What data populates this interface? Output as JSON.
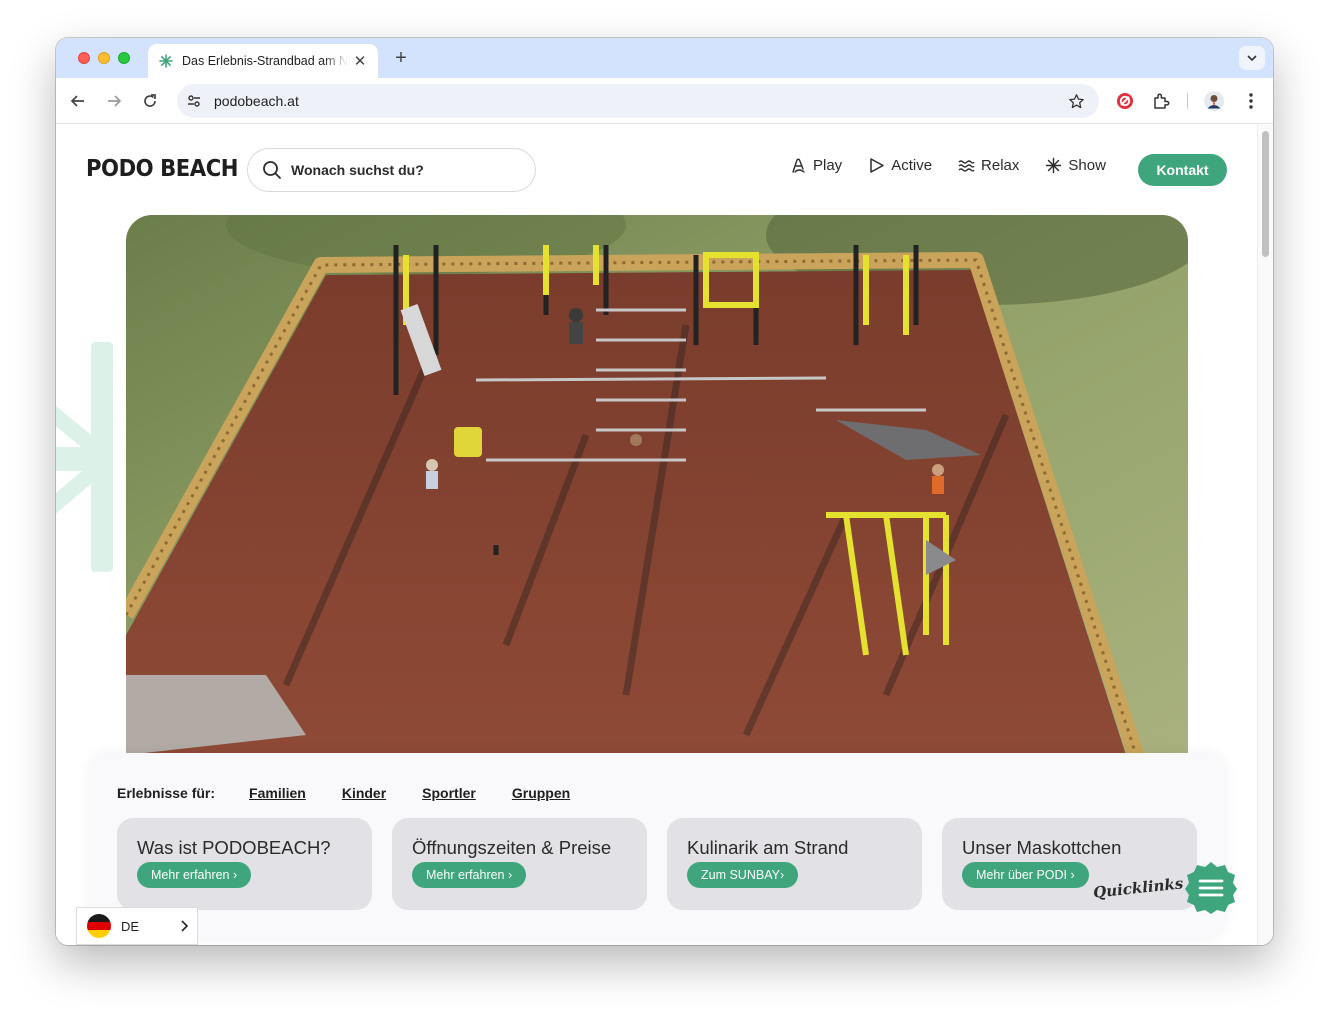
{
  "browser": {
    "tab_title": "Das Erlebnis-Strandbad am N",
    "tab_close": "✕",
    "new_tab": "+",
    "url": "podobeach.at"
  },
  "site": {
    "logo": "PODO BEACH",
    "search_placeholder": "Wonach suchst du?",
    "nav": [
      {
        "label": "Play",
        "icon": "play-hand-icon"
      },
      {
        "label": "Active",
        "icon": "active-triangle-icon"
      },
      {
        "label": "Relax",
        "icon": "waves-icon"
      },
      {
        "label": "Show",
        "icon": "sparkle-icon"
      }
    ],
    "contact_button": "Kontakt",
    "accent_color": "#3fa57c"
  },
  "experiences": {
    "label": "Erlebnisse für:",
    "links": [
      "Familien",
      "Kinder",
      "Sportler",
      "Gruppen"
    ]
  },
  "cards": [
    {
      "title": "Was ist PODOBEACH?",
      "button": "Mehr erfahren ›"
    },
    {
      "title": "Öffnungszeiten & Preise",
      "button": "Mehr erfahren ›"
    },
    {
      "title": "Kulinarik am Strand",
      "button": "Zum SUNBAY›"
    },
    {
      "title": "Unser Maskottchen",
      "button": "Mehr über PODI ›"
    }
  ],
  "quicklinks": "Quicklinks",
  "language": {
    "code": "DE"
  }
}
